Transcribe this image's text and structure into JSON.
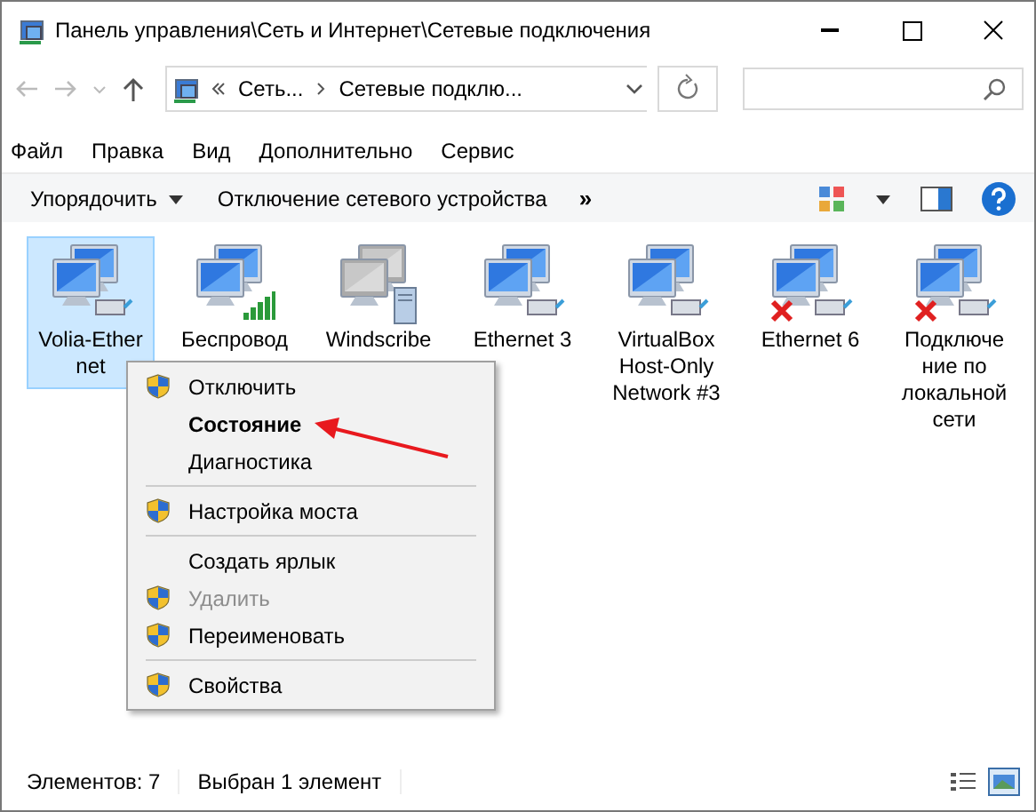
{
  "window": {
    "title": "Панель управления\\Сеть и Интернет\\Сетевые подключения"
  },
  "address": {
    "crumbs": [
      "Сеть...",
      "Сетевые подклю..."
    ]
  },
  "menu_bar": [
    "Файл",
    "Правка",
    "Вид",
    "Дополнительно",
    "Сервис"
  ],
  "toolbar": {
    "organize": "Упорядочить",
    "action": "Отключение сетевого устройства",
    "more": "»"
  },
  "items": [
    {
      "label": "Volia-Ether\nnet",
      "kind": "ethernet",
      "selected": true
    },
    {
      "label": "Беспровод",
      "kind": "wireless",
      "selected": false
    },
    {
      "label": "Windscribe",
      "kind": "vpn",
      "selected": false
    },
    {
      "label": "Ethernet 3",
      "kind": "ethernet",
      "selected": false
    },
    {
      "label": "VirtualBox\nHost-Only\nNetwork #3",
      "kind": "ethernet",
      "selected": false
    },
    {
      "label": "Ethernet 6",
      "kind": "disconnected",
      "selected": false
    },
    {
      "label": "Подключе\nние по\nлокальной\nсети",
      "kind": "disconnected",
      "selected": false
    }
  ],
  "context_menu": [
    {
      "kind": "item",
      "label": "Отключить",
      "shield": true,
      "bold": false,
      "disabled": false
    },
    {
      "kind": "item",
      "label": "Состояние",
      "shield": false,
      "bold": true,
      "disabled": false
    },
    {
      "kind": "item",
      "label": "Диагностика",
      "shield": false,
      "bold": false,
      "disabled": false
    },
    {
      "kind": "separator"
    },
    {
      "kind": "item",
      "label": "Настройка моста",
      "shield": true,
      "bold": false,
      "disabled": false
    },
    {
      "kind": "separator"
    },
    {
      "kind": "item",
      "label": "Создать ярлык",
      "shield": false,
      "bold": false,
      "disabled": false
    },
    {
      "kind": "item",
      "label": "Удалить",
      "shield": true,
      "bold": false,
      "disabled": true
    },
    {
      "kind": "item",
      "label": "Переименовать",
      "shield": true,
      "bold": false,
      "disabled": false
    },
    {
      "kind": "separator"
    },
    {
      "kind": "item",
      "label": "Свойства",
      "shield": true,
      "bold": false,
      "disabled": false
    }
  ],
  "status_bar": {
    "count": "Элементов: 7",
    "selection": "Выбран 1 элемент"
  }
}
